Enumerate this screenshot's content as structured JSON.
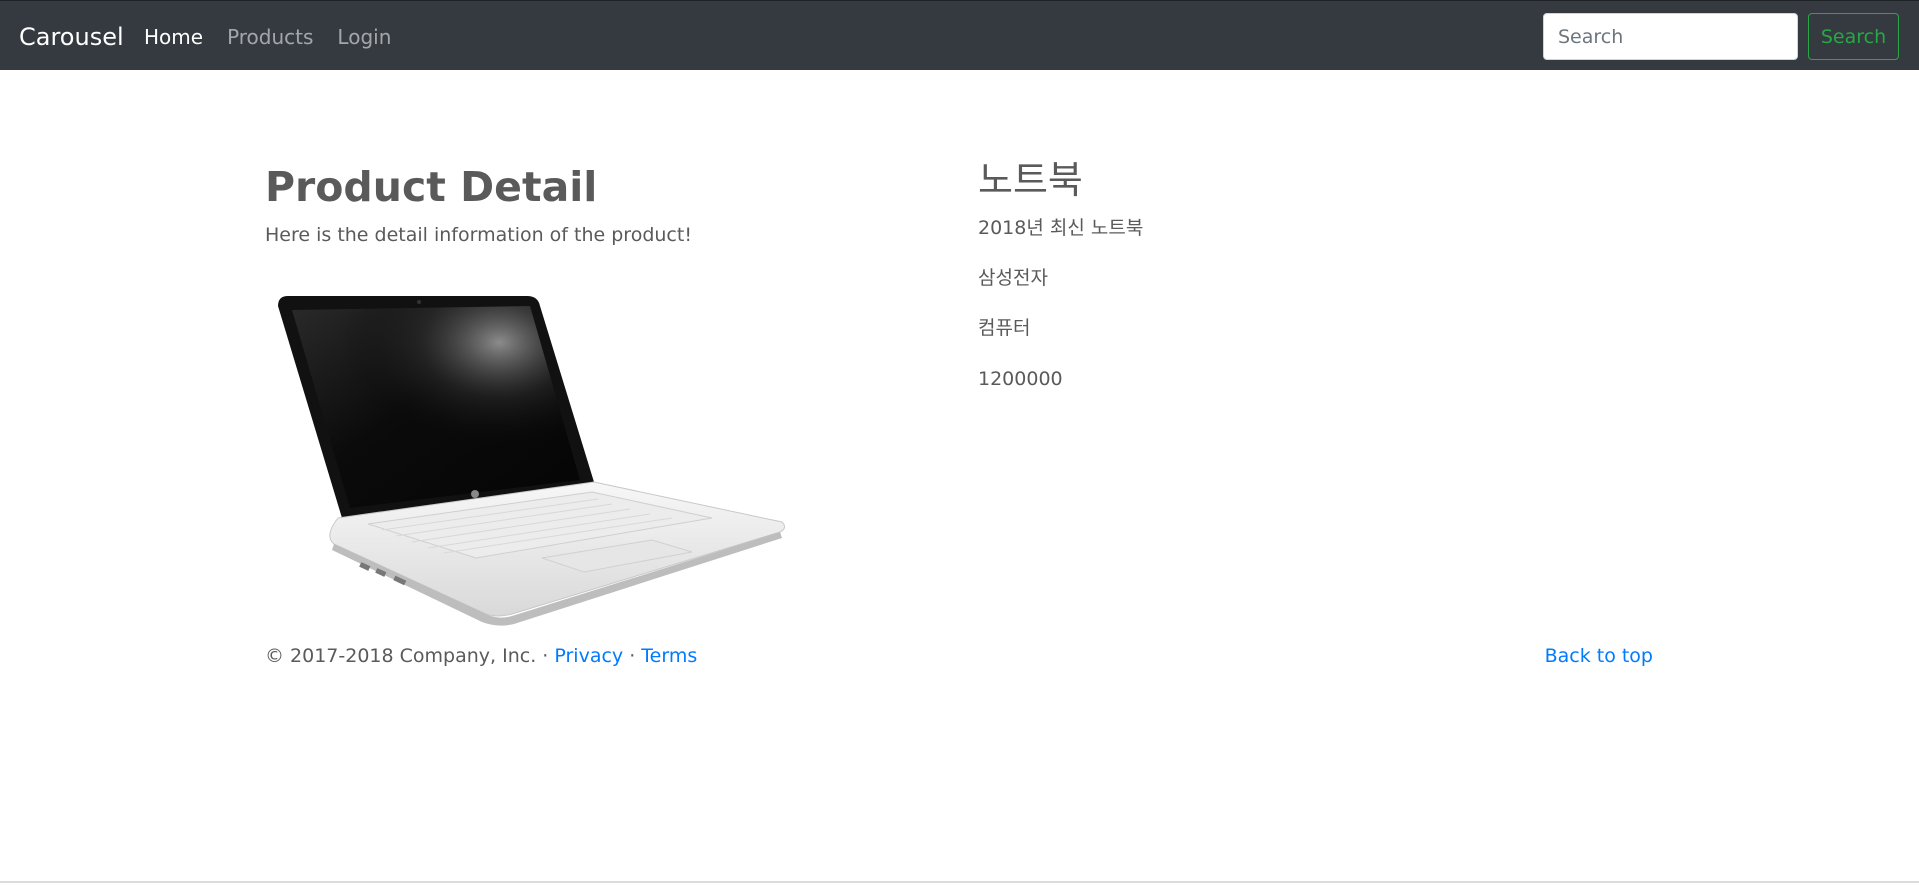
{
  "navbar": {
    "brand": "Carousel",
    "links": [
      {
        "label": "Home",
        "active": true
      },
      {
        "label": "Products",
        "active": false
      },
      {
        "label": "Login",
        "active": false
      }
    ],
    "search_placeholder": "Search",
    "search_button": "Search"
  },
  "main": {
    "title": "Product Detail",
    "lead": "Here is the detail information of the product!",
    "image_icon": "laptop-image"
  },
  "product": {
    "name": "노트북",
    "description": "2018년 최신 노트북",
    "maker": "삼성전자",
    "category": "컴퓨터",
    "price": "1200000"
  },
  "footer": {
    "copyright": "© 2017-2018 Company, Inc. · ",
    "privacy": "Privacy",
    "separator": " · ",
    "terms": "Terms",
    "back_to_top": "Back to top"
  },
  "colors": {
    "navbar_bg": "#343a40",
    "link": "#007bff",
    "search_button": "#28a745",
    "text": "#5a5a5a"
  }
}
